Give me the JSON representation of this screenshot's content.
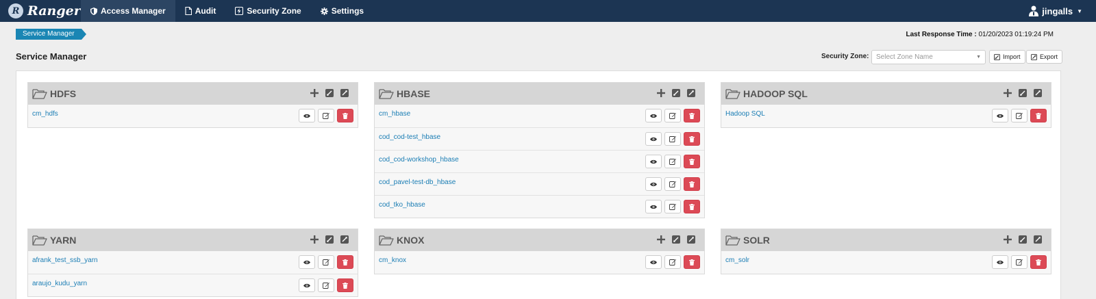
{
  "brand": {
    "name": "Ranger",
    "logo_letter": "R"
  },
  "nav": [
    {
      "label": "Access Manager",
      "icon": "shield-icon",
      "active": true
    },
    {
      "label": "Audit",
      "icon": "file-icon",
      "active": false
    },
    {
      "label": "Security Zone",
      "icon": "bolt-square-icon",
      "active": false
    },
    {
      "label": "Settings",
      "icon": "gear-icon",
      "active": false
    }
  ],
  "user": {
    "name": "jingalls",
    "icon": "user-icon"
  },
  "breadcrumb": {
    "label": "Service Manager"
  },
  "response": {
    "label": "Last Response Time :",
    "value": "01/20/2023 01:19:24 PM"
  },
  "page": {
    "title": "Service Manager"
  },
  "zone": {
    "label": "Security Zone:",
    "placeholder": "Select Zone Name"
  },
  "toolbar": {
    "import_label": "Import",
    "export_label": "Export"
  },
  "colors": {
    "nav_bg": "#1c3553",
    "crumb": "#1a86b4",
    "link": "#1a7db4",
    "delete": "#dc4a56",
    "panel_header": "#d6d6d6"
  },
  "services": [
    {
      "title": "HDFS",
      "items": [
        "cm_hdfs"
      ]
    },
    {
      "title": "HBASE",
      "items": [
        "cm_hbase",
        "cod_cod-test_hbase",
        "cod_cod-workshop_hbase",
        "cod_pavel-test-db_hbase",
        "cod_tko_hbase"
      ]
    },
    {
      "title": "HADOOP SQL",
      "items": [
        "Hadoop SQL"
      ]
    },
    {
      "title": "YARN",
      "items": [
        "afrank_test_ssb_yarn",
        "araujo_kudu_yarn"
      ]
    },
    {
      "title": "KNOX",
      "items": [
        "cm_knox"
      ]
    },
    {
      "title": "SOLR",
      "items": [
        "cm_solr"
      ]
    }
  ]
}
